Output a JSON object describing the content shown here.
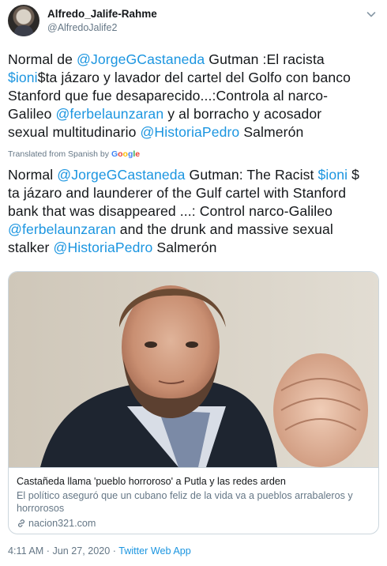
{
  "tweet": {
    "author_name": "Alfredo_Jalife-Rahme",
    "author_handle": "@AlfredoJalife2",
    "original_lines": [
      [
        {
          "t": "Normal de ",
          "l": false
        },
        {
          "t": "@JorgeGCastaneda",
          "l": true
        },
        {
          "t": " Gutman :El racista",
          "l": false
        }
      ],
      [
        {
          "t": "$ioni",
          "l": true
        },
        {
          "t": "$ta jázaro y lavador del cartel del Golfo con banco",
          "l": false
        }
      ],
      [
        {
          "t": "Stanford que fue desaparecido...:Controla al narco-",
          "l": false
        }
      ],
      [
        {
          "t": "Galileo ",
          "l": false
        },
        {
          "t": "@ferbelaunzaran",
          "l": true
        },
        {
          "t": " y al borracho y acosador",
          "l": false
        }
      ],
      [
        {
          "t": "sexual multitudinario ",
          "l": false
        },
        {
          "t": "@HistoriaPedro",
          "l": true
        },
        {
          "t": " Salmerón",
          "l": false
        }
      ]
    ],
    "translated_from": "Translated from Spanish by",
    "translator": "Google",
    "translated_lines": [
      [
        {
          "t": "Normal ",
          "l": false
        },
        {
          "t": "@JorgeGCastaneda",
          "l": true
        },
        {
          "t": " Gutman: The Racist ",
          "l": false
        },
        {
          "t": "$ioni",
          "l": true
        },
        {
          "t": " $",
          "l": false
        }
      ],
      [
        {
          "t": "ta jázaro and launderer of the Gulf cartel with Stanford",
          "l": false
        }
      ],
      [
        {
          "t": "bank that was disappeared ...: Control narco-Galileo",
          "l": false
        }
      ],
      [
        {
          "t": "@ferbelaunzaran",
          "l": true
        },
        {
          "t": " and the drunk and massive sexual",
          "l": false
        }
      ],
      [
        {
          "t": "stalker ",
          "l": false
        },
        {
          "t": "@HistoriaPedro",
          "l": true
        },
        {
          "t": " Salmerón",
          "l": false
        }
      ]
    ],
    "timestamp": "4:11 AM · Jun 27, 2020 · ",
    "source": "Twitter Web App"
  },
  "card": {
    "title": "Castañeda llama 'pueblo horroroso' a Putla y las redes arden",
    "description_lines": [
      "El político aseguró que un cubano feliz de la vida va a pueblos arrabaleros y",
      "horrorosos"
    ],
    "domain": "nacion321.com"
  },
  "colors": {
    "link": "#1b95e0",
    "text": "#14171a",
    "secondary": "#657786",
    "border": "#ccd6dd"
  },
  "icons": {
    "caret": "chevron-down-icon",
    "domain": "link-icon"
  }
}
